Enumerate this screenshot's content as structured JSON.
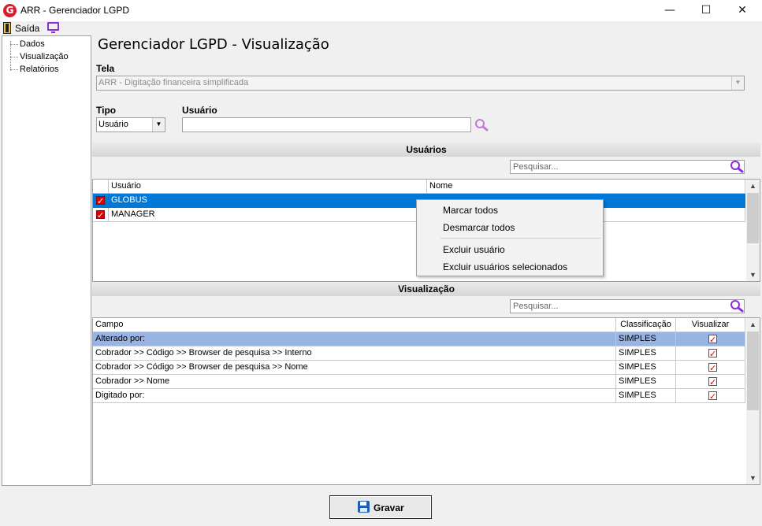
{
  "window": {
    "title": "ARR - Gerenciador LGPD",
    "minimize": "—",
    "maximize": "☐",
    "close": "✕"
  },
  "toolbar": {
    "exit_label": "Saída"
  },
  "tree": {
    "items": [
      "Dados",
      "Visualização",
      "Relatórios"
    ]
  },
  "page_title": "Gerenciador LGPD - Visualização",
  "tela": {
    "label": "Tela",
    "value": "ARR - Digitação financeira simplificada"
  },
  "tipo": {
    "label": "Tipo",
    "value": "Usuário"
  },
  "usuario_field": {
    "label": "Usuário",
    "value": ""
  },
  "usuarios_section": {
    "title": "Usuários",
    "search_placeholder": "Pesquisar...",
    "columns": [
      "Usuário",
      "Nome"
    ],
    "rows": [
      {
        "usuario": "GLOBUS",
        "nome": "",
        "checked": true,
        "selected": true
      },
      {
        "usuario": "MANAGER",
        "nome": "",
        "checked": true,
        "selected": false
      }
    ]
  },
  "context_menu": {
    "items": [
      "Marcar todos",
      "Desmarcar todos",
      "Excluir usuário",
      "Excluir usuários selecionados"
    ]
  },
  "visualizacao_section": {
    "title": "Visualização",
    "search_placeholder": "Pesquisar...",
    "columns": [
      "Campo",
      "Classificação",
      "Visualizar"
    ],
    "rows": [
      {
        "campo": "Alterado por:",
        "classificacao": "SIMPLES",
        "visualizar": true,
        "selected": true
      },
      {
        "campo": "Cobrador >> Código >> Browser de pesquisa >> Interno",
        "classificacao": "SIMPLES",
        "visualizar": true,
        "selected": false
      },
      {
        "campo": "Cobrador >> Código >> Browser de pesquisa >> Nome",
        "classificacao": "SIMPLES",
        "visualizar": true,
        "selected": false
      },
      {
        "campo": "Cobrador >> Nome",
        "classificacao": "SIMPLES",
        "visualizar": true,
        "selected": false
      },
      {
        "campo": "Digitado por:",
        "classificacao": "SIMPLES",
        "visualizar": true,
        "selected": false
      }
    ]
  },
  "save_button": {
    "label": "Gravar"
  },
  "colors": {
    "selected_row_blue": "#0078d7",
    "selected_row_light": "#99b4e2",
    "search_icon": "#8a2be2",
    "checkmark": "#dd0000"
  }
}
